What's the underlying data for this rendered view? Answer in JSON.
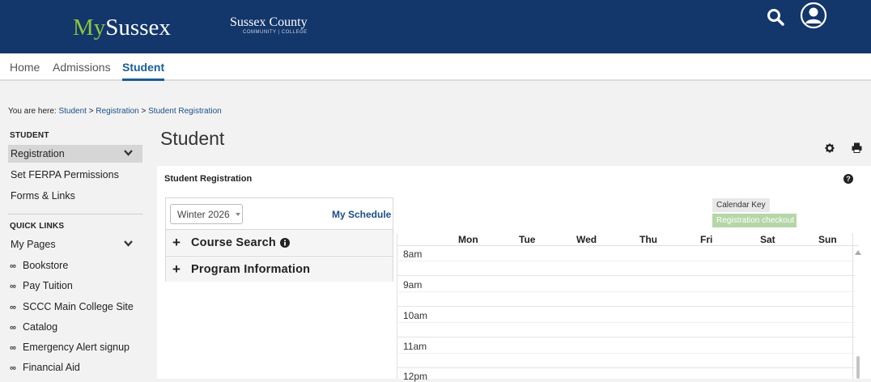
{
  "header": {
    "brand_prefix": "My",
    "brand_suffix": "Sussex",
    "college_name": "Sussex County",
    "college_sub": "COMMUNITY | COLLEGE",
    "search_icon": "search-icon",
    "user_icon": "user-circle-icon",
    "brand_color": "#13366b",
    "accent_green": "#8cc63f"
  },
  "nav": {
    "items": [
      {
        "label": "Home"
      },
      {
        "label": "Admissions"
      },
      {
        "label": "Student",
        "active": true
      }
    ]
  },
  "breadcrumb": {
    "prefix": "You are here:",
    "items": [
      "Student",
      "Registration",
      "Student Registration"
    ],
    "separator": ">"
  },
  "sidebar": {
    "section_title": "STUDENT",
    "items": [
      {
        "label": "Registration",
        "selected": true,
        "expandable": true
      },
      {
        "label": "Set FERPA Permissions"
      },
      {
        "label": "Forms & Links"
      }
    ],
    "quick_links_title": "QUICK LINKS",
    "my_pages": "My Pages",
    "links": [
      {
        "label": "Bookstore",
        "icon": "link-icon"
      },
      {
        "label": "Pay Tuition",
        "icon": "link-icon"
      },
      {
        "label": "SCCC Main College Site",
        "icon": "link-icon"
      },
      {
        "label": "Catalog",
        "icon": "link-icon"
      },
      {
        "label": "Emergency Alert signup",
        "icon": "link-icon"
      },
      {
        "label": "Financial Aid",
        "icon": "link-icon"
      }
    ]
  },
  "main": {
    "page_title": "Student",
    "panel_title": "Student Registration",
    "term_value": "Winter 2026",
    "my_schedule": "My Schedule",
    "accordions": [
      {
        "label": "Course Search",
        "has_info": true
      },
      {
        "label": "Program Information"
      }
    ],
    "calendar_key": "Calendar Key",
    "registration_checkout": "Registration checkout"
  },
  "calendar": {
    "days": [
      "Mon",
      "Tue",
      "Wed",
      "Thu",
      "Fri",
      "Sat",
      "Sun"
    ],
    "hours": [
      "8am",
      "9am",
      "10am",
      "11am",
      "12pm"
    ]
  }
}
